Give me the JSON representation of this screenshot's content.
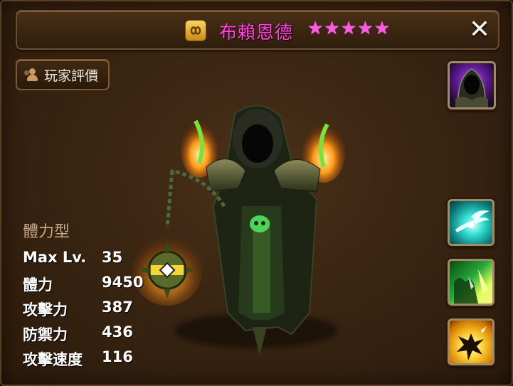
{
  "header": {
    "element_icon": "element-rune-icon",
    "monster_name": "布賴恩德",
    "stars": [
      "★",
      "★",
      "★",
      "★",
      "★"
    ],
    "star_count": 5,
    "close_icon": "close-icon",
    "close_glyph": "✕"
  },
  "review_button": {
    "label": "玩家評價",
    "icon": "users-icon"
  },
  "right_column": {
    "portrait_icon": "hooded-reaper-portrait-icon",
    "skills": [
      {
        "icon": "winged-slash-skill-icon"
      },
      {
        "icon": "green-claw-skill-icon"
      },
      {
        "icon": "yellow-burst-skill-icon"
      }
    ]
  },
  "stats": {
    "type": "體力型",
    "rows": [
      {
        "label": "Max Lv.",
        "value": "35"
      },
      {
        "label": "體力",
        "value": "9450"
      },
      {
        "label": "攻擊力",
        "value": "387"
      },
      {
        "label": "防禦力",
        "value": "436"
      },
      {
        "label": "攻擊速度",
        "value": "116"
      }
    ]
  },
  "colors": {
    "name": "#ff48d2",
    "stars": "#ff5bdc",
    "panel_bg": "#3a2512",
    "border": "#6e4e2c",
    "stat_type": "#c4a788"
  }
}
